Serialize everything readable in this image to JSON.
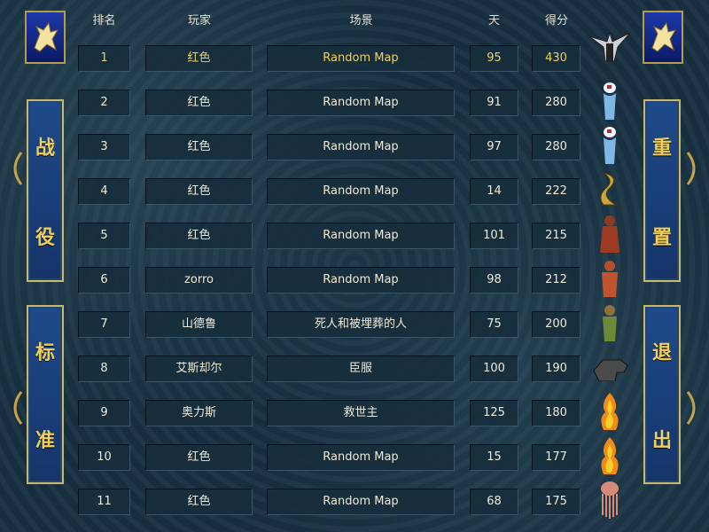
{
  "header": {
    "rank": "排名",
    "player": "玩家",
    "scene": "场景",
    "days": "天",
    "score": "得分"
  },
  "left_panel": {
    "campaign": [
      "战",
      "役"
    ],
    "standard": [
      "标",
      "准"
    ]
  },
  "right_panel": {
    "reset": [
      "重",
      "置"
    ],
    "exit": [
      "退",
      "出"
    ]
  },
  "colors": {
    "highlight_text": "#f2d05d",
    "normal_text": "#f1ead7",
    "panel_text": "#f0cf58",
    "panel_bg": "#1f4a8a",
    "banner_bg": "#1d38a8"
  },
  "rows": [
    {
      "rank": "1",
      "player": "红色",
      "scene": "Random Map",
      "days": "95",
      "score": "430",
      "portrait": "angel-icon"
    },
    {
      "rank": "2",
      "player": "红色",
      "scene": "Random Map",
      "days": "91",
      "score": "280",
      "portrait": "water-elemental-icon"
    },
    {
      "rank": "3",
      "player": "红色",
      "scene": "Random Map",
      "days": "97",
      "score": "280",
      "portrait": "water-elemental-icon"
    },
    {
      "rank": "4",
      "player": "红色",
      "scene": "Random Map",
      "days": "14",
      "score": "222",
      "portrait": "naga-icon"
    },
    {
      "rank": "5",
      "player": "红色",
      "scene": "Random Map",
      "days": "101",
      "score": "215",
      "portrait": "monk-icon"
    },
    {
      "rank": "6",
      "player": "zorro",
      "scene": "Random Map",
      "days": "98",
      "score": "212",
      "portrait": "efreet-icon"
    },
    {
      "rank": "7",
      "player": "山德鲁",
      "scene": "死人和被埋葬的人",
      "days": "75",
      "score": "200",
      "portrait": "orc-icon"
    },
    {
      "rank": "8",
      "player": "艾斯却尔",
      "scene": "臣服",
      "days": "100",
      "score": "190",
      "portrait": "wolf-icon"
    },
    {
      "rank": "9",
      "player": "奥力斯",
      "scene": "救世主",
      "days": "125",
      "score": "180",
      "portrait": "fire-elemental-icon"
    },
    {
      "rank": "10",
      "player": "红色",
      "scene": "Random Map",
      "days": "15",
      "score": "177",
      "portrait": "fire-elemental-icon"
    },
    {
      "rank": "11",
      "player": "红色",
      "scene": "Random Map",
      "days": "68",
      "score": "175",
      "portrait": "jellyfish-icon"
    }
  ]
}
